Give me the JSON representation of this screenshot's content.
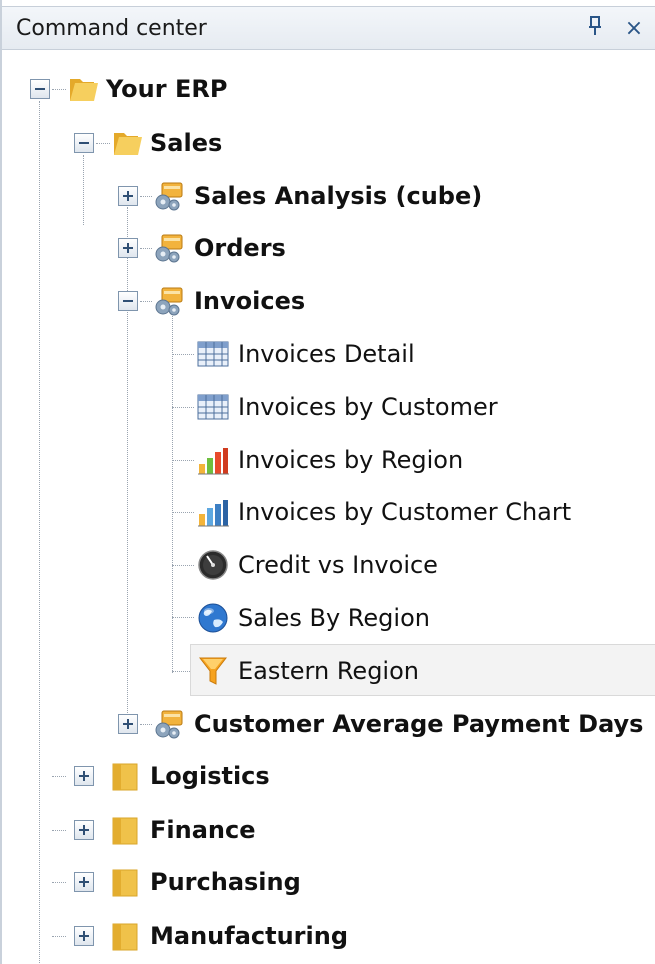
{
  "header": {
    "title": "Command center",
    "pin_glyph": "ᵽ",
    "close_glyph": "×"
  },
  "tree": {
    "root": {
      "label": "Your ERP"
    },
    "sales": {
      "label": "Sales"
    },
    "sales_children": [
      {
        "label": "Sales Analysis (cube)"
      },
      {
        "label": "Orders"
      },
      {
        "label": "Invoices"
      },
      {
        "label": "Customer Average Payment Days"
      }
    ],
    "invoice_reports": [
      {
        "label": "Invoices Detail",
        "icon": "grid-report-icon"
      },
      {
        "label": "Invoices by Customer",
        "icon": "grid-report-icon"
      },
      {
        "label": "Invoices by Region",
        "icon": "bar-chart-icon"
      },
      {
        "label": "Invoices by Customer Chart",
        "icon": "bar-chart-icon"
      },
      {
        "label": "Credit vs Invoice",
        "icon": "gauge-icon"
      },
      {
        "label": "Sales By Region",
        "icon": "globe-icon"
      },
      {
        "label": "Eastern Region",
        "icon": "filter-icon"
      }
    ],
    "top_folders": [
      {
        "label": "Logistics"
      },
      {
        "label": "Finance"
      },
      {
        "label": "Purchasing"
      },
      {
        "label": "Manufacturing"
      }
    ]
  },
  "colors": {
    "folder": "#f0c24a",
    "header_bg": "#e6ebf1",
    "selection": "#f3f3f3"
  }
}
